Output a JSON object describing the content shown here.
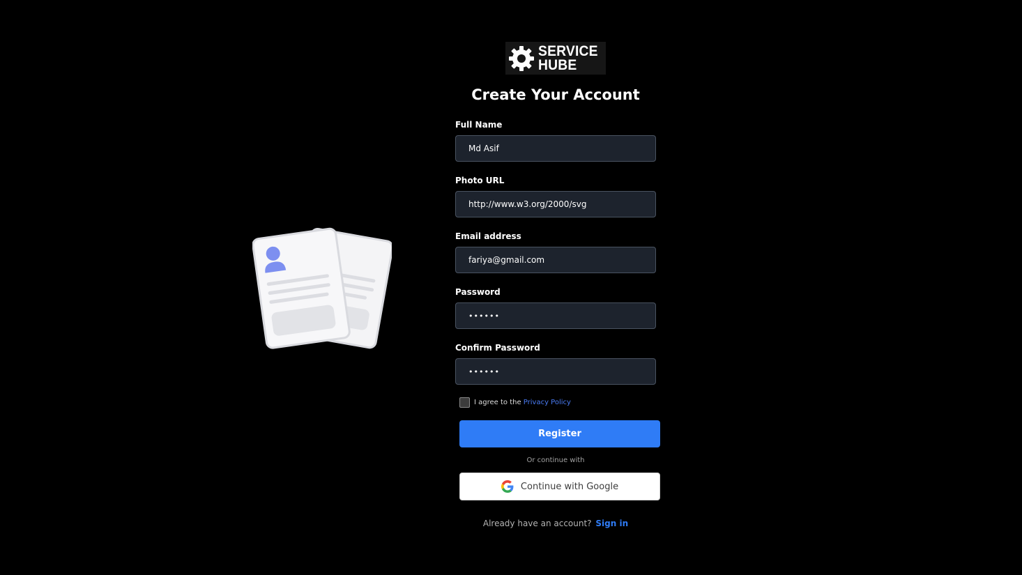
{
  "brand": {
    "line1": "SERVICE",
    "line2": "HUBE",
    "icon": "gear-icon"
  },
  "form": {
    "title": "Create Your Account",
    "fields": [
      {
        "label": "Full Name",
        "value": "Md Asif",
        "type": "text"
      },
      {
        "label": "Photo URL",
        "value": "http://www.w3.org/2000/svg",
        "type": "text"
      },
      {
        "label": "Email address",
        "value": "fariya@gmail.com",
        "type": "email"
      },
      {
        "label": "Password",
        "value": "••••••",
        "type": "password"
      },
      {
        "label": "Confirm Password",
        "value": "••••••",
        "type": "password"
      }
    ],
    "agree_text": "I agree to the",
    "privacy_link": "Privacy Policy",
    "agree_checked": false,
    "register_label": "Register",
    "or_text": "Or continue with",
    "google_label": "Continue with Google",
    "signin_prompt": "Already have an account?",
    "signin_link": "Sign in"
  },
  "colors": {
    "background": "#000000",
    "input_bg": "#1d232d",
    "primary": "#2f7cf6",
    "link": "#4a7cf5"
  }
}
